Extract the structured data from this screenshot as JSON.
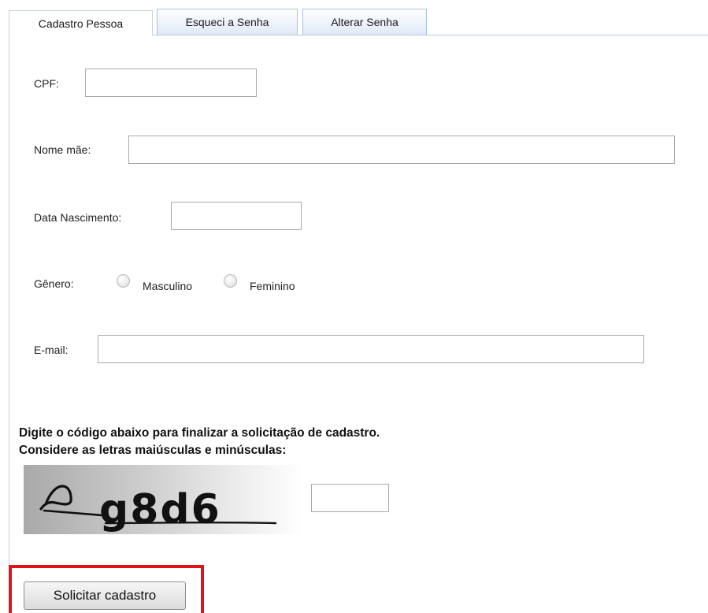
{
  "tabs": [
    {
      "label": "Cadastro Pessoa",
      "active": true
    },
    {
      "label": "Esqueci a Senha",
      "active": false
    },
    {
      "label": "Alterar Senha",
      "active": false
    }
  ],
  "form": {
    "cpf_label": "CPF:",
    "cpf_value": "",
    "nome_mae_label": "Nome mãe:",
    "nome_mae_value": "",
    "data_nascimento_label": "Data Nascimento:",
    "data_nascimento_value": "",
    "genero_label": "Gênero:",
    "genero_options": [
      "Masculino",
      "Feminino"
    ],
    "email_label": "E-mail:",
    "email_value": ""
  },
  "captcha": {
    "instruction_line1": "Digite o código abaixo para finalizar a solicitação de cadastro.",
    "instruction_line2": "Considere as letras maiúsculas e minúsculas:",
    "image_text": "g8d6",
    "input_value": ""
  },
  "submit_label": "Solicitar cadastro",
  "colors": {
    "tab_border": "#a9c1de",
    "highlight": "#e0121b"
  }
}
